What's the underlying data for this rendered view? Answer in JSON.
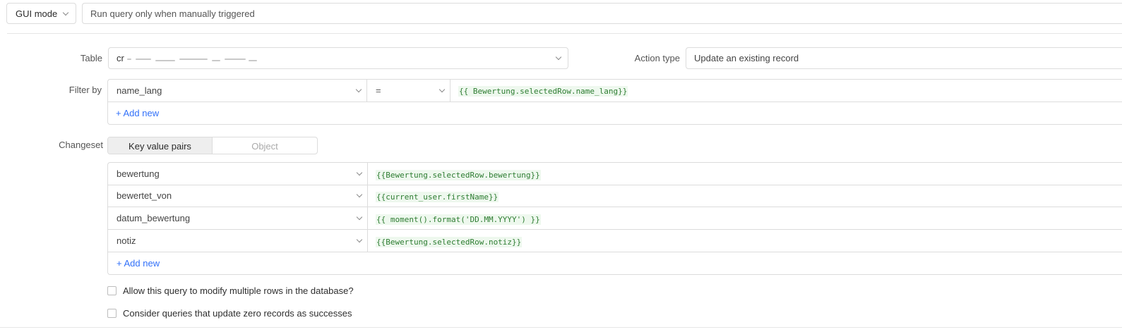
{
  "toolbar": {
    "mode_label": "GUI mode",
    "trigger_label": "Run query only when manually triggered"
  },
  "table": {
    "label": "Table",
    "value": "cr"
  },
  "action": {
    "label": "Action type",
    "value": "Update an existing record"
  },
  "filter": {
    "label": "Filter by",
    "column": "name_lang",
    "operator": "=",
    "value": "{{ Bewertung.selectedRow.name_lang}}",
    "add_new": "+ Add new"
  },
  "changeset": {
    "label": "Changeset",
    "tabs": [
      {
        "label": "Key value pairs",
        "active": true
      },
      {
        "label": "Object",
        "active": false
      }
    ],
    "rows": [
      {
        "key": "bewertung",
        "value": "{{Bewertung.selectedRow.bewertung}}"
      },
      {
        "key": "bewertet_von",
        "value": "{{current_user.firstName}}"
      },
      {
        "key": "datum_bewertung",
        "value": "{{ moment().format('DD.MM.YYYY') }}"
      },
      {
        "key": "notiz",
        "value": "{{Bewertung.selectedRow.notiz}}"
      }
    ],
    "add_new": "+ Add new"
  },
  "options": {
    "multiple_rows": "Allow this query to modify multiple rows in the database?",
    "zero_records": "Consider queries that update zero records as successes"
  },
  "colors": {
    "accent": "#3170f9",
    "code_text": "#2e7d32",
    "code_bg": "#eef8ee",
    "border": "#dcdcdc"
  }
}
